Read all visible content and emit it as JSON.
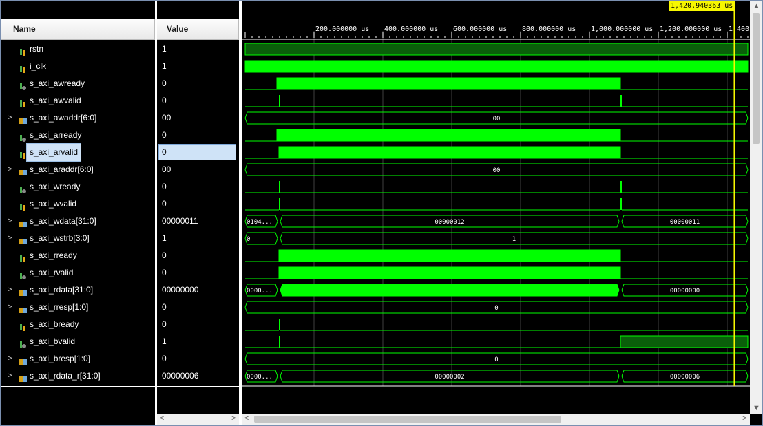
{
  "header": {
    "name_col": "Name",
    "value_col": "Value"
  },
  "cursor": {
    "label": "1,420.940363 us",
    "time_us": 1420.94
  },
  "ruler": {
    "unit": "us",
    "ticks": [
      {
        "label": "200.000000 us",
        "t": 200
      },
      {
        "label": "400.000000 us",
        "t": 400
      },
      {
        "label": "600.000000 us",
        "t": 600
      },
      {
        "label": "800.000000 us",
        "t": 800
      },
      {
        "label": "1,000.000000 us",
        "t": 1000
      },
      {
        "label": "1,200.000000 us",
        "t": 1200
      },
      {
        "label": "1,400.",
        "t": 1400
      }
    ]
  },
  "selected_signal": "s_axi_arvalid",
  "signals": [
    {
      "name": "rstn",
      "value": "1",
      "kind": "bit",
      "expandable": false,
      "icon": "input-bit-icon"
    },
    {
      "name": "i_clk",
      "value": "1",
      "kind": "bit",
      "expandable": false,
      "icon": "input-bit-icon"
    },
    {
      "name": "s_axi_awready",
      "value": "0",
      "kind": "bit",
      "expandable": false,
      "icon": "output-bit-icon"
    },
    {
      "name": "s_axi_awvalid",
      "value": "0",
      "kind": "bit",
      "expandable": false,
      "icon": "input-bit-icon"
    },
    {
      "name": "s_axi_awaddr[6:0]",
      "value": "00",
      "kind": "bus",
      "expandable": true,
      "icon": "bus-icon"
    },
    {
      "name": "s_axi_arready",
      "value": "0",
      "kind": "bit",
      "expandable": false,
      "icon": "output-bit-icon"
    },
    {
      "name": "s_axi_arvalid",
      "value": "0",
      "kind": "bit",
      "expandable": false,
      "icon": "input-bit-icon"
    },
    {
      "name": "s_axi_araddr[6:0]",
      "value": "00",
      "kind": "bus",
      "expandable": true,
      "icon": "bus-icon"
    },
    {
      "name": "s_axi_wready",
      "value": "0",
      "kind": "bit",
      "expandable": false,
      "icon": "output-bit-icon"
    },
    {
      "name": "s_axi_wvalid",
      "value": "0",
      "kind": "bit",
      "expandable": false,
      "icon": "input-bit-icon"
    },
    {
      "name": "s_axi_wdata[31:0]",
      "value": "00000011",
      "kind": "bus",
      "expandable": true,
      "icon": "bus-icon"
    },
    {
      "name": "s_axi_wstrb[3:0]",
      "value": "1",
      "kind": "bus",
      "expandable": true,
      "icon": "bus-icon"
    },
    {
      "name": "s_axi_rready",
      "value": "0",
      "kind": "bit",
      "expandable": false,
      "icon": "input-bit-icon"
    },
    {
      "name": "s_axi_rvalid",
      "value": "0",
      "kind": "bit",
      "expandable": false,
      "icon": "output-bit-icon"
    },
    {
      "name": "s_axi_rdata[31:0]",
      "value": "00000000",
      "kind": "bus",
      "expandable": true,
      "icon": "bus-icon"
    },
    {
      "name": "s_axi_rresp[1:0]",
      "value": "0",
      "kind": "bus",
      "expandable": true,
      "icon": "bus-icon"
    },
    {
      "name": "s_axi_bready",
      "value": "0",
      "kind": "bit",
      "expandable": false,
      "icon": "input-bit-icon"
    },
    {
      "name": "s_axi_bvalid",
      "value": "1",
      "kind": "bit",
      "expandable": false,
      "icon": "output-bit-icon"
    },
    {
      "name": "s_axi_bresp[1:0]",
      "value": "0",
      "kind": "bus",
      "expandable": true,
      "icon": "bus-icon"
    },
    {
      "name": "s_axi_rdata_r[31:0]",
      "value": "00000006",
      "kind": "bus",
      "expandable": true,
      "icon": "bus-icon"
    }
  ],
  "waveforms": [
    {
      "type": "bit",
      "segments": [
        {
          "t0": 0,
          "t1": 1460,
          "v": "high-dim"
        }
      ]
    },
    {
      "type": "clock",
      "segments": [
        {
          "t0": 0,
          "t1": 1460,
          "v": "solid"
        }
      ]
    },
    {
      "type": "bit",
      "segments": [
        {
          "t0": 92,
          "t1": 1090,
          "v": "high"
        }
      ]
    },
    {
      "type": "bit",
      "segments": [
        {
          "t0": 98,
          "t1": 102,
          "v": "pulse"
        },
        {
          "t0": 1090,
          "t1": 1094,
          "v": "pulse"
        }
      ]
    },
    {
      "type": "bus",
      "segments": [
        {
          "t0": 0,
          "t1": 1460,
          "label": "00"
        }
      ]
    },
    {
      "type": "bit",
      "segments": [
        {
          "t0": 92,
          "t1": 1090,
          "v": "high"
        }
      ]
    },
    {
      "type": "bit",
      "segments": [
        {
          "t0": 98,
          "t1": 1090,
          "v": "high"
        }
      ]
    },
    {
      "type": "bus",
      "segments": [
        {
          "t0": 0,
          "t1": 1460,
          "label": "00"
        }
      ]
    },
    {
      "type": "bit",
      "segments": [
        {
          "t0": 98,
          "t1": 102,
          "v": "pulse"
        },
        {
          "t0": 1090,
          "t1": 1094,
          "v": "pulse"
        }
      ]
    },
    {
      "type": "bit",
      "segments": [
        {
          "t0": 98,
          "t1": 102,
          "v": "pulse"
        },
        {
          "t0": 1090,
          "t1": 1094,
          "v": "pulse"
        }
      ]
    },
    {
      "type": "bus",
      "segments": [
        {
          "t0": 0,
          "t1": 98,
          "label": "0104..."
        },
        {
          "t0": 98,
          "t1": 1090,
          "label": "00000012"
        },
        {
          "t0": 1090,
          "t1": 1460,
          "label": "00000011"
        }
      ]
    },
    {
      "type": "bus",
      "segments": [
        {
          "t0": 0,
          "t1": 98,
          "label": "0"
        },
        {
          "t0": 98,
          "t1": 1460,
          "label": "1"
        }
      ]
    },
    {
      "type": "bit",
      "segments": [
        {
          "t0": 98,
          "t1": 1090,
          "v": "high"
        }
      ]
    },
    {
      "type": "bit",
      "segments": [
        {
          "t0": 98,
          "t1": 1090,
          "v": "high"
        }
      ]
    },
    {
      "type": "bus",
      "segments": [
        {
          "t0": 0,
          "t1": 98,
          "label": "0000..."
        },
        {
          "t0": 98,
          "t1": 1090,
          "label": "",
          "fill": "solid"
        },
        {
          "t0": 1090,
          "t1": 1460,
          "label": "00000000"
        }
      ]
    },
    {
      "type": "bus",
      "segments": [
        {
          "t0": 0,
          "t1": 1460,
          "label": "0"
        }
      ]
    },
    {
      "type": "bit",
      "segments": [
        {
          "t0": 98,
          "t1": 102,
          "v": "pulse"
        }
      ]
    },
    {
      "type": "bit",
      "segments": [
        {
          "t0": 98,
          "t1": 102,
          "v": "pulse"
        },
        {
          "t0": 1090,
          "t1": 1460,
          "v": "high-dim"
        }
      ]
    },
    {
      "type": "bus",
      "segments": [
        {
          "t0": 0,
          "t1": 1460,
          "label": "0"
        }
      ]
    },
    {
      "type": "bus",
      "segments": [
        {
          "t0": 0,
          "t1": 98,
          "label": "0000..."
        },
        {
          "t0": 98,
          "t1": 1090,
          "label": "00000002"
        },
        {
          "t0": 1090,
          "t1": 1460,
          "label": "00000006"
        }
      ]
    }
  ],
  "colors": {
    "wave_green": "#00ff00",
    "wave_dim_green": "#0a5f0a",
    "grid": "#404040",
    "cursor": "#f7f700",
    "selection": "#cfe3f7",
    "background": "#000000"
  }
}
